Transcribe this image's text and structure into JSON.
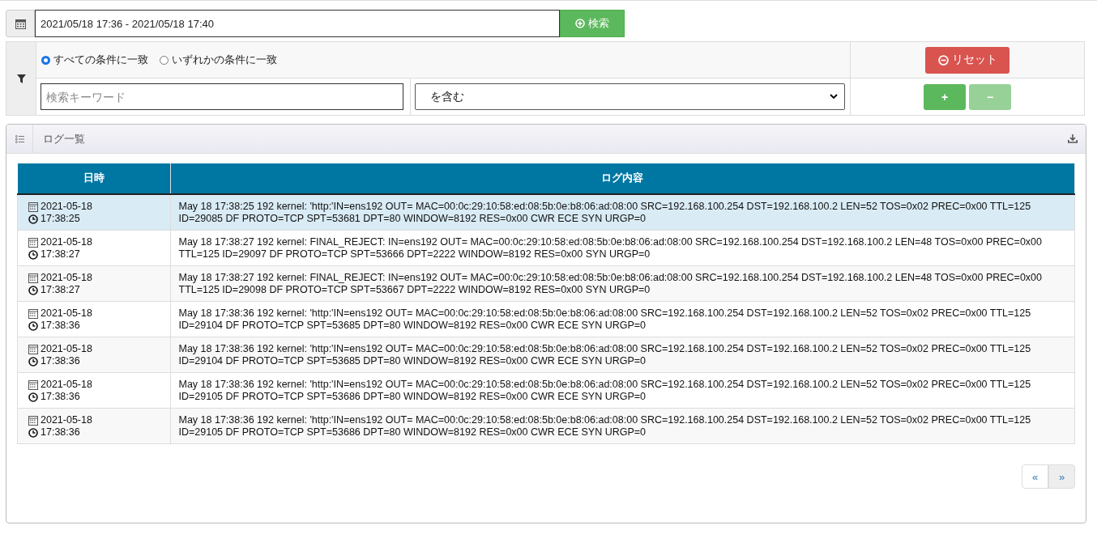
{
  "date_range": {
    "value": "2021/05/18 17:36 - 2021/05/18 17:40"
  },
  "search_button": "検索",
  "match_options": [
    {
      "label": "すべての条件に一致",
      "selected": true
    },
    {
      "label": "いずれかの条件に一致",
      "selected": false
    }
  ],
  "keyword": {
    "placeholder": "検索キーワード"
  },
  "condition": {
    "value": "を含む"
  },
  "reset_button": "リセット",
  "add_button": {
    "label": "+",
    "disabled": false
  },
  "remove_button": {
    "label": "−",
    "disabled": true
  },
  "log_panel": {
    "title": "ログ一覧",
    "table": {
      "columns": [
        "日時",
        "ログ内容"
      ],
      "rows": [
        {
          "date": "2021-05-18",
          "time": "17:38:25",
          "selected": true,
          "log": "May 18 17:38:25 192 kernel: 'http:'IN=ens192 OUT= MAC=00:0c:29:10:58:ed:08:5b:0e:b8:06:ad:08:00 SRC=192.168.100.254 DST=192.168.100.2 LEN=52 TOS=0x02 PREC=0x00 TTL=125 ID=29085 DF PROTO=TCP SPT=53681 DPT=80 WINDOW=8192 RES=0x00 CWR ECE SYN URGP=0"
        },
        {
          "date": "2021-05-18",
          "time": "17:38:27",
          "selected": false,
          "log": "May 18 17:38:27 192 kernel: FINAL_REJECT: IN=ens192 OUT= MAC=00:0c:29:10:58:ed:08:5b:0e:b8:06:ad:08:00 SRC=192.168.100.254 DST=192.168.100.2 LEN=48 TOS=0x00 PREC=0x00 TTL=125 ID=29097 DF PROTO=TCP SPT=53666 DPT=2222 WINDOW=8192 RES=0x00 SYN URGP=0"
        },
        {
          "date": "2021-05-18",
          "time": "17:38:27",
          "selected": false,
          "log": "May 18 17:38:27 192 kernel: FINAL_REJECT: IN=ens192 OUT= MAC=00:0c:29:10:58:ed:08:5b:0e:b8:06:ad:08:00 SRC=192.168.100.254 DST=192.168.100.2 LEN=48 TOS=0x00 PREC=0x00 TTL=125 ID=29098 DF PROTO=TCP SPT=53667 DPT=2222 WINDOW=8192 RES=0x00 SYN URGP=0"
        },
        {
          "date": "2021-05-18",
          "time": "17:38:36",
          "selected": false,
          "log": "May 18 17:38:36 192 kernel: 'http:'IN=ens192 OUT= MAC=00:0c:29:10:58:ed:08:5b:0e:b8:06:ad:08:00 SRC=192.168.100.254 DST=192.168.100.2 LEN=52 TOS=0x02 PREC=0x00 TTL=125 ID=29104 DF PROTO=TCP SPT=53685 DPT=80 WINDOW=8192 RES=0x00 CWR ECE SYN URGP=0"
        },
        {
          "date": "2021-05-18",
          "time": "17:38:36",
          "selected": false,
          "log": "May 18 17:38:36 192 kernel: 'http:'IN=ens192 OUT= MAC=00:0c:29:10:58:ed:08:5b:0e:b8:06:ad:08:00 SRC=192.168.100.254 DST=192.168.100.2 LEN=52 TOS=0x02 PREC=0x00 TTL=125 ID=29104 DF PROTO=TCP SPT=53685 DPT=80 WINDOW=8192 RES=0x00 CWR ECE SYN URGP=0"
        },
        {
          "date": "2021-05-18",
          "time": "17:38:36",
          "selected": false,
          "log": "May 18 17:38:36 192 kernel: 'http:'IN=ens192 OUT= MAC=00:0c:29:10:58:ed:08:5b:0e:b8:06:ad:08:00 SRC=192.168.100.254 DST=192.168.100.2 LEN=52 TOS=0x02 PREC=0x00 TTL=125 ID=29105 DF PROTO=TCP SPT=53686 DPT=80 WINDOW=8192 RES=0x00 CWR ECE SYN URGP=0"
        },
        {
          "date": "2021-05-18",
          "time": "17:38:36",
          "selected": false,
          "log": "May 18 17:38:36 192 kernel: 'http:'IN=ens192 OUT= MAC=00:0c:29:10:58:ed:08:5b:0e:b8:06:ad:08:00 SRC=192.168.100.254 DST=192.168.100.2 LEN=52 TOS=0x02 PREC=0x00 TTL=125 ID=29105 DF PROTO=TCP SPT=53686 DPT=80 WINDOW=8192 RES=0x00 CWR ECE SYN URGP=0"
        }
      ]
    }
  },
  "pagination": [
    {
      "label": "«",
      "disabled": false
    },
    {
      "label": "»",
      "disabled": true
    }
  ]
}
